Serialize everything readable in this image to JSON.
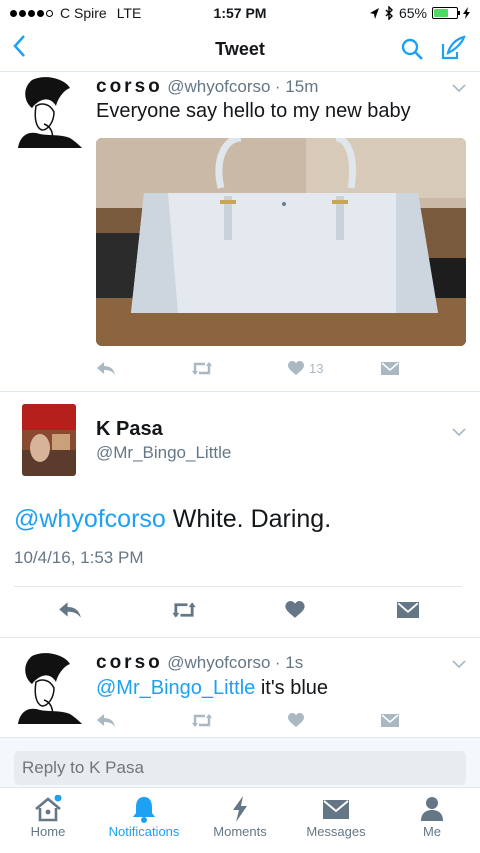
{
  "status_bar": {
    "carrier": "C Spire",
    "network": "LTE",
    "time": "1:57 PM",
    "battery": "65%",
    "battery_level": 0.65
  },
  "nav": {
    "title": "Tweet"
  },
  "tweet1": {
    "display_name": "corso",
    "handle": "@whyofcorso",
    "time": "· 15m",
    "text": "Everyone say hello to my new baby",
    "likes": "13"
  },
  "main_tweet": {
    "display_name": "K Pasa",
    "handle": "@Mr_Bingo_Little",
    "mention": "@whyofcorso",
    "text": " White. Daring.",
    "timestamp": "10/4/16, 1:53 PM"
  },
  "reply": {
    "display_name": "corso",
    "handle": "@whyofcorso",
    "time": "· 1s",
    "mention": "@Mr_Bingo_Little",
    "text": " it's blue"
  },
  "reply_box": {
    "placeholder": "Reply to K Pasa"
  },
  "tabs": [
    {
      "label": "Home"
    },
    {
      "label": "Notifications"
    },
    {
      "label": "Moments"
    },
    {
      "label": "Messages"
    },
    {
      "label": "Me"
    }
  ],
  "colors": {
    "accent": "#1da1f2",
    "muted": "#aab8c2",
    "battery": "#4cd964"
  }
}
